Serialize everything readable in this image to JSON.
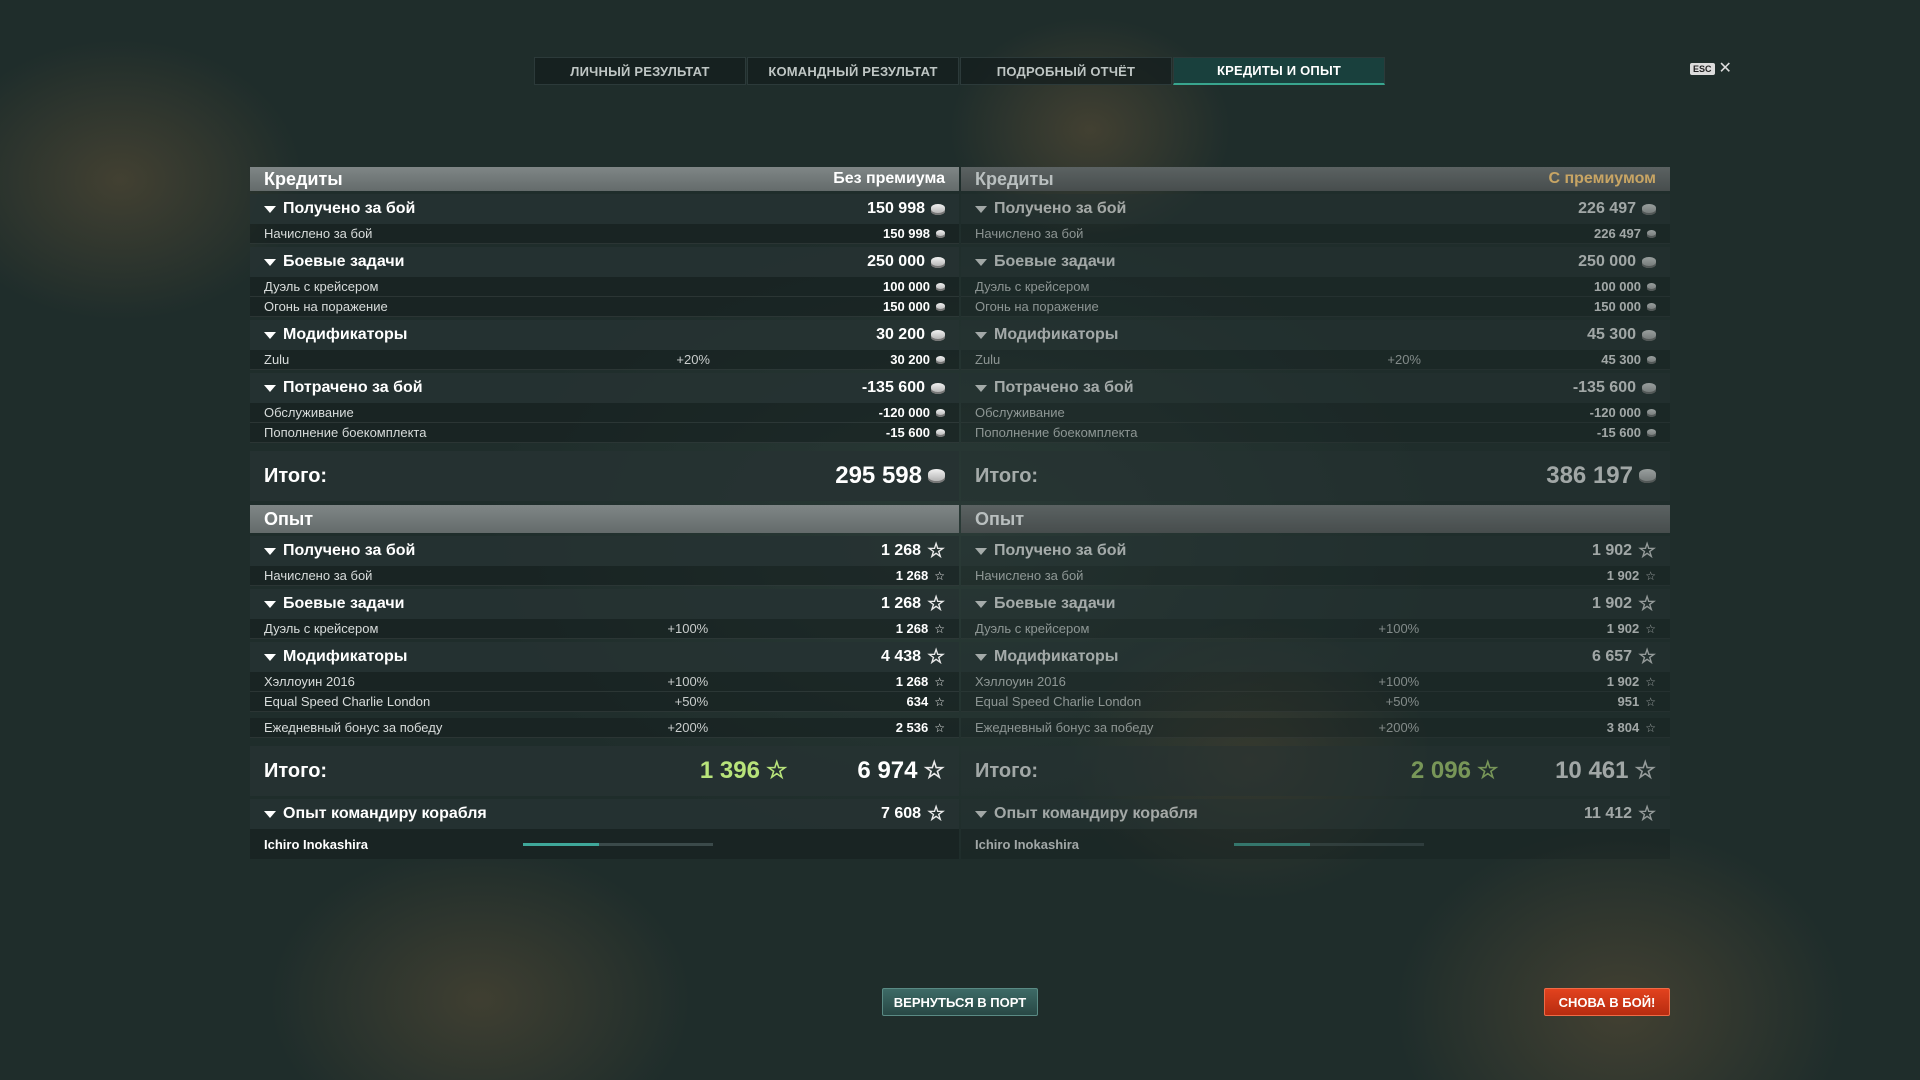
{
  "tabs": [
    {
      "label": "ЛИЧНЫЙ РЕЗУЛЬТАТ"
    },
    {
      "label": "КОМАНДНЫЙ РЕЗУЛЬТАТ"
    },
    {
      "label": "ПОДРОБНЫЙ ОТЧЁТ"
    },
    {
      "label": "КРЕДИТЫ И ОПЫТ",
      "active": true
    }
  ],
  "close": {
    "key": "ESC",
    "icon": "close-icon"
  },
  "left": {
    "credits_title": "Кредиты",
    "credits_sub": "Без премиума",
    "earned": {
      "label": "Получено за бой",
      "value": "150 998"
    },
    "earned_items": [
      {
        "label": "Начислено за бой",
        "value": "150 998"
      }
    ],
    "missions": {
      "label": "Боевые задачи",
      "value": "250 000"
    },
    "missions_items": [
      {
        "label": "Дуэль с крейсером",
        "value": "100 000"
      },
      {
        "label": "Огонь на поражение",
        "value": "150 000"
      }
    ],
    "modifiers": {
      "label": "Модификаторы",
      "value": "30 200"
    },
    "modifiers_items": [
      {
        "label": "Zulu",
        "pct": "+20%",
        "value": "30 200"
      }
    ],
    "spent": {
      "label": "Потрачено за бой",
      "value": "-135 600"
    },
    "spent_items": [
      {
        "label": "Обслуживание",
        "value": "-120 000"
      },
      {
        "label": "Пополнение боекомплекта",
        "value": "-15 600"
      }
    ],
    "total": {
      "label": "Итого:",
      "value": "295 598"
    },
    "exp_title": "Опыт",
    "xp_earned": {
      "label": "Получено за бой",
      "value": "1 268"
    },
    "xp_earned_items": [
      {
        "label": "Начислено за бой",
        "value": "1 268"
      }
    ],
    "xp_missions": {
      "label": "Боевые задачи",
      "value": "1 268"
    },
    "xp_missions_items": [
      {
        "label": "Дуэль с крейсером",
        "pct": "+100%",
        "value": "1 268"
      }
    ],
    "xp_modifiers": {
      "label": "Модификаторы",
      "value": "4 438"
    },
    "xp_modifiers_items": [
      {
        "label": "Хэллоуин 2016",
        "pct": "+100%",
        "value": "1 268"
      },
      {
        "label": "Equal Speed Charlie London",
        "pct": "+50%",
        "value": "634"
      },
      {
        "label": "Ежедневный бонус за победу",
        "pct": "+200%",
        "value": "2 536"
      }
    ],
    "xp_total": {
      "label": "Итого:",
      "free": "1 396",
      "value": "6 974"
    },
    "commander": {
      "label": "Опыт командиру корабля",
      "value": "7 608",
      "name": "Ichiro Inokashira",
      "progress": 0.4
    }
  },
  "right": {
    "credits_title": "Кредиты",
    "credits_sub": "С премиумом",
    "earned": {
      "label": "Получено за бой",
      "value": "226 497"
    },
    "earned_items": [
      {
        "label": "Начислено за бой",
        "value": "226 497"
      }
    ],
    "missions": {
      "label": "Боевые задачи",
      "value": "250 000"
    },
    "missions_items": [
      {
        "label": "Дуэль с крейсером",
        "value": "100 000"
      },
      {
        "label": "Огонь на поражение",
        "value": "150 000"
      }
    ],
    "modifiers": {
      "label": "Модификаторы",
      "value": "45 300"
    },
    "modifiers_items": [
      {
        "label": "Zulu",
        "pct": "+20%",
        "value": "45 300"
      }
    ],
    "spent": {
      "label": "Потрачено за бой",
      "value": "-135 600"
    },
    "spent_items": [
      {
        "label": "Обслуживание",
        "value": "-120 000"
      },
      {
        "label": "Пополнение боекомплекта",
        "value": "-15 600"
      }
    ],
    "total": {
      "label": "Итого:",
      "value": "386 197"
    },
    "exp_title": "Опыт",
    "xp_earned": {
      "label": "Получено за бой",
      "value": "1 902"
    },
    "xp_earned_items": [
      {
        "label": "Начислено за бой",
        "value": "1 902"
      }
    ],
    "xp_missions": {
      "label": "Боевые задачи",
      "value": "1 902"
    },
    "xp_missions_items": [
      {
        "label": "Дуэль с крейсером",
        "pct": "+100%",
        "value": "1 902"
      }
    ],
    "xp_modifiers": {
      "label": "Модификаторы",
      "value": "6 657"
    },
    "xp_modifiers_items": [
      {
        "label": "Хэллоуин 2016",
        "pct": "+100%",
        "value": "1 902"
      },
      {
        "label": "Equal Speed Charlie London",
        "pct": "+50%",
        "value": "951"
      },
      {
        "label": "Ежедневный бонус за победу",
        "pct": "+200%",
        "value": "3 804"
      }
    ],
    "xp_total": {
      "label": "Итого:",
      "free": "2 096",
      "value": "10 461"
    },
    "commander": {
      "label": "Опыт командиру корабля",
      "value": "11 412",
      "name": "Ichiro Inokashira",
      "progress": 0.4
    }
  },
  "buttons": {
    "port": "ВЕРНУТЬСЯ В ПОРТ",
    "battle": "СНОВА В БОЙ!"
  },
  "colors": {
    "accent": "#39a58e",
    "premium": "#c8a564",
    "free_xp": "#b8e37a",
    "battle": "#d0361a"
  }
}
